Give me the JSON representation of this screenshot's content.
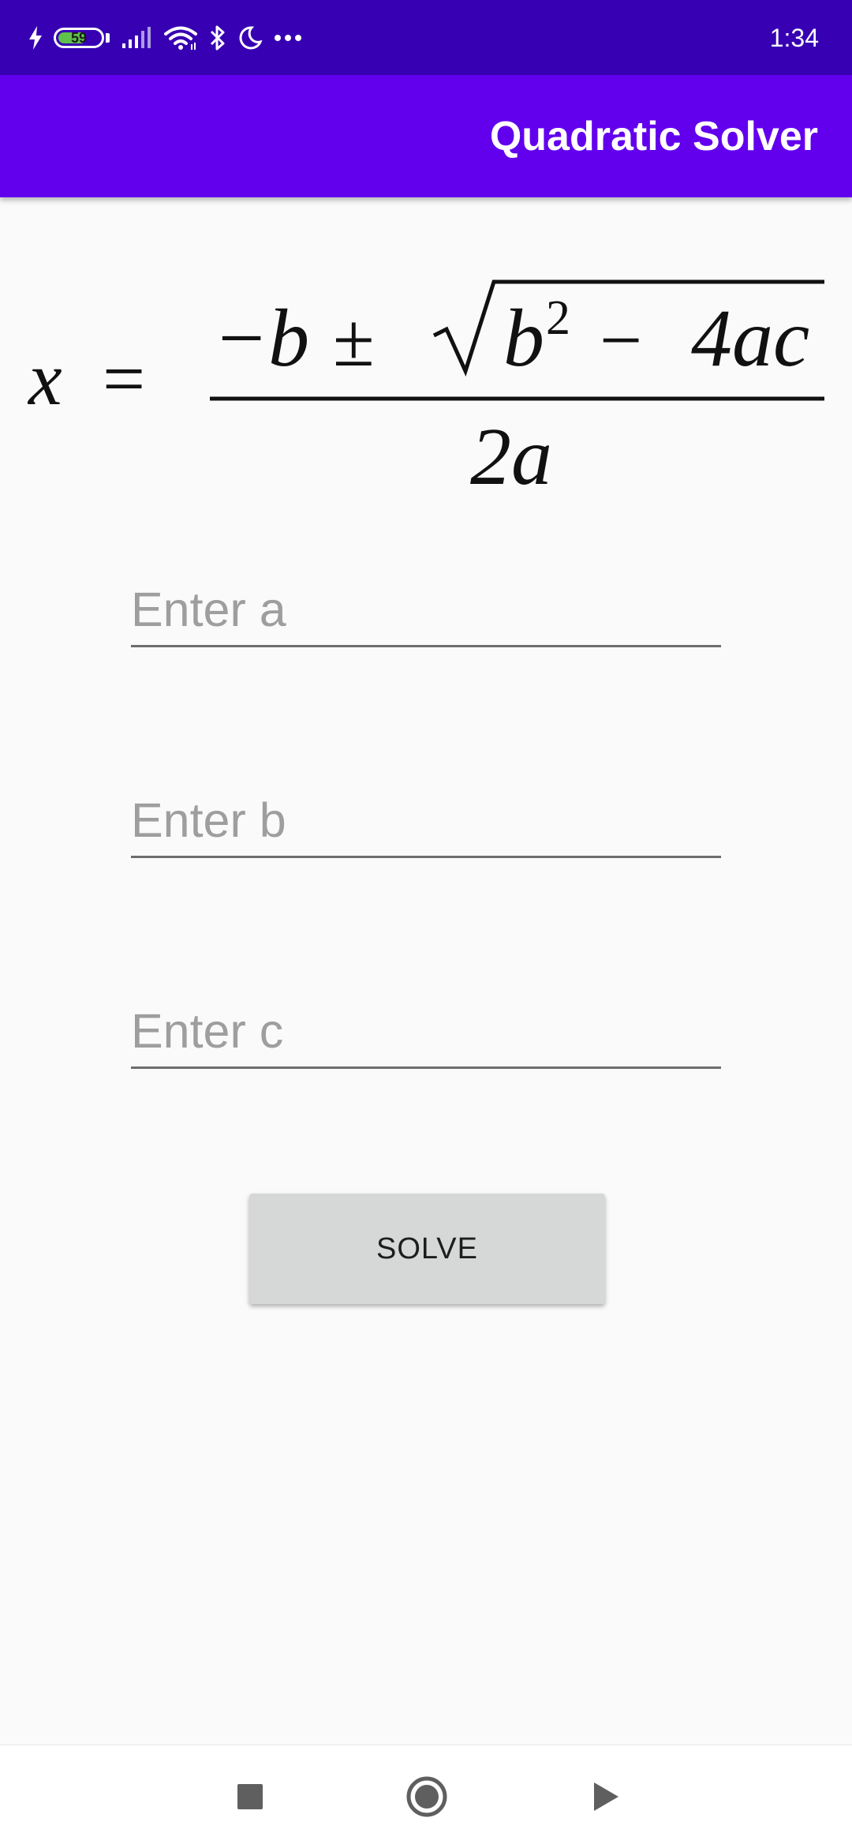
{
  "status_bar": {
    "battery_level": "59",
    "time": "1:34",
    "icons": [
      "charging-bolt-icon",
      "battery-icon",
      "cellular-signal-icon",
      "wifi-icon",
      "bluetooth-icon",
      "do-not-disturb-moon-icon",
      "more-dots-icon"
    ]
  },
  "app_bar": {
    "title": "Quadratic Solver",
    "color": "#6200ee"
  },
  "formula": {
    "lhs_var": "x",
    "equals": "=",
    "minus_b": "−b",
    "plus_minus": "±",
    "b": "b",
    "exponent": "2",
    "minus": "−",
    "four_ac": "4ac",
    "denominator": "2a"
  },
  "inputs": {
    "a_placeholder": "Enter a",
    "b_placeholder": "Enter b",
    "c_placeholder": "Enter c",
    "a_value": "",
    "b_value": "",
    "c_value": ""
  },
  "solve_button": {
    "label": "SOLVE"
  },
  "nav_bar": {
    "icons": [
      "recents-square-icon",
      "home-circle-icon",
      "back-triangle-icon"
    ]
  },
  "colors": {
    "status_bar": "#3700b3",
    "app_bar": "#6200ee",
    "background": "#fafafa",
    "button": "#d6d7d7"
  }
}
